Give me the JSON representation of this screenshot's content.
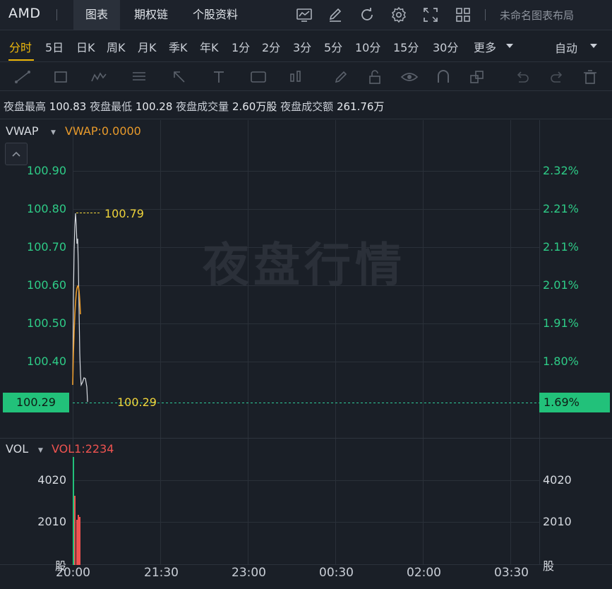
{
  "header": {
    "ticker": "AMD",
    "tabs": [
      "图表",
      "期权链",
      "个股资料"
    ],
    "layout_name": "未命名图表布局",
    "icons": [
      "indicator-icon",
      "draw-edit-icon",
      "refresh-icon",
      "settings-icon",
      "fullscreen-icon",
      "layout-grid-icon"
    ]
  },
  "periods": {
    "items": [
      "分时",
      "5日",
      "日K",
      "周K",
      "月K",
      "季K",
      "年K",
      "1分",
      "2分",
      "3分",
      "5分",
      "10分",
      "15分",
      "30分",
      "更多"
    ],
    "active_index": 0,
    "auto": "自动"
  },
  "drawing_tools": [
    "trend-line-icon",
    "rectangle-icon",
    "pattern-icon",
    "fib-icon",
    "arrow-icon",
    "text-icon",
    "annotation-icon",
    "measure-icon",
    "pen-icon",
    "lock-icon",
    "eye-icon",
    "magnet-icon",
    "layers-icon",
    "undo-icon",
    "redo-icon",
    "trash-icon"
  ],
  "info": {
    "high_label": "夜盘最高",
    "high_value": "100.83",
    "low_label": "夜盘最低",
    "low_value": "100.28",
    "volume_label": "夜盘成交量",
    "volume_value": "2.60万股",
    "amount_label": "夜盘成交额",
    "amount_value": "261.76万"
  },
  "watermark": "夜盘行情",
  "indicators": {
    "main_name": "VWAP",
    "main_value": "VWAP:0.0000",
    "sub_name": "VOL",
    "sub_value": "VOL1:2234"
  },
  "price_axis": [
    "100.90",
    "100.80",
    "100.70",
    "100.60",
    "100.50",
    "100.40"
  ],
  "pct_axis": [
    "2.32%",
    "2.21%",
    "2.11%",
    "2.01%",
    "1.91%",
    "1.80%"
  ],
  "vol_axis": [
    "4020",
    "2010"
  ],
  "vol_unit": "股",
  "time_axis": [
    "20:00",
    "21:30",
    "23:00",
    "00:30",
    "02:00",
    "03:30"
  ],
  "current": {
    "price": "100.29",
    "pct": "1.69%"
  },
  "max_marker": "100.79",
  "colors": {
    "up": "#22c17a",
    "down": "#ef5350",
    "vwap": "#e89a2b",
    "price_line": "#d7dbe1",
    "marker": "#f0d43a"
  }
}
